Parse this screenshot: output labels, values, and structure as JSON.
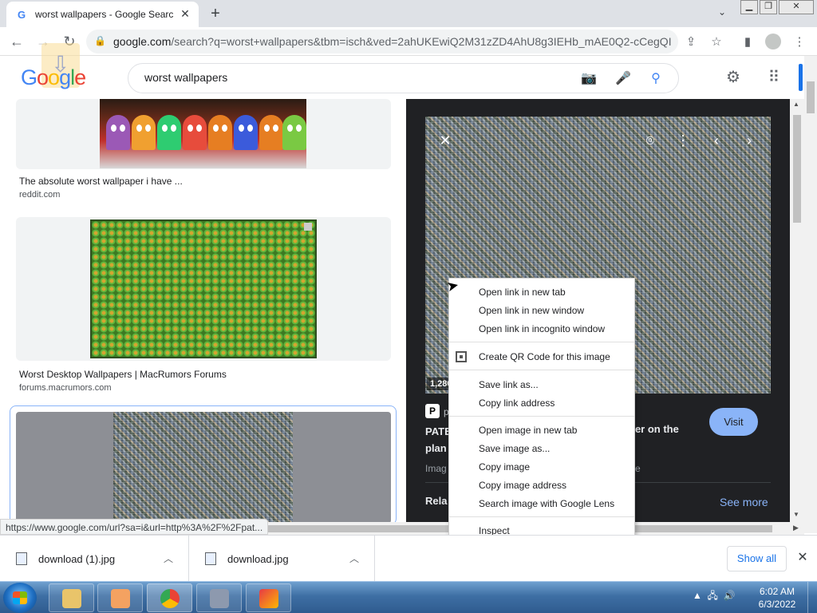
{
  "browser": {
    "tab_title": "worst wallpapers - Google Searc",
    "tab_favicon": "G",
    "url_host": "google.com",
    "url_path": "/search?q=worst+wallpapers&tbm=isch&ved=2ahUKEwiQ2M31zZD4AhU8g3IEHb_mAE0Q2-cCegQI..."
  },
  "google": {
    "logo_letters": [
      "G",
      "o",
      "o",
      "g",
      "l",
      "e"
    ],
    "search_value": "worst wallpapers"
  },
  "results": [
    {
      "caption": "The absolute worst wallpaper i have ...",
      "source": "reddit.com"
    },
    {
      "caption": "Worst Desktop Wallpapers | MacRumors Forums",
      "source": "forums.macrumors.com"
    }
  ],
  "preview": {
    "dimensions": "1,280",
    "site_letter": "P",
    "site": "p",
    "title_left": "PATE",
    "title_left_2": "plan",
    "title_right": "per on the",
    "note_left": "Imag",
    "note_right": "re",
    "visit_label": "Visit",
    "related_label": "Rela",
    "see_more_label": "See more"
  },
  "status_url": "https://www.google.com/url?sa=i&url=http%3A%2F%2Fpat...",
  "context_menu": {
    "group1": [
      "Open link in new tab",
      "Open link in new window",
      "Open link in incognito window"
    ],
    "qr_label": "Create QR Code for this image",
    "group2": [
      "Save link as...",
      "Copy link address"
    ],
    "group3": [
      "Open image in new tab",
      "Save image as...",
      "Copy image",
      "Copy image address",
      "Search image with Google Lens"
    ],
    "inspect_label": "Inspect"
  },
  "downloads": {
    "files": [
      "download (1).jpg",
      "download.jpg"
    ],
    "show_all_label": "Show all"
  },
  "taskbar": {
    "time": "6:02 AM",
    "date": "6/3/2022"
  },
  "colors": {
    "google_blue": "#4285f4",
    "link_blue": "#1a73e8",
    "preview_bg": "#202124",
    "visit_button": "#8ab4f8"
  }
}
